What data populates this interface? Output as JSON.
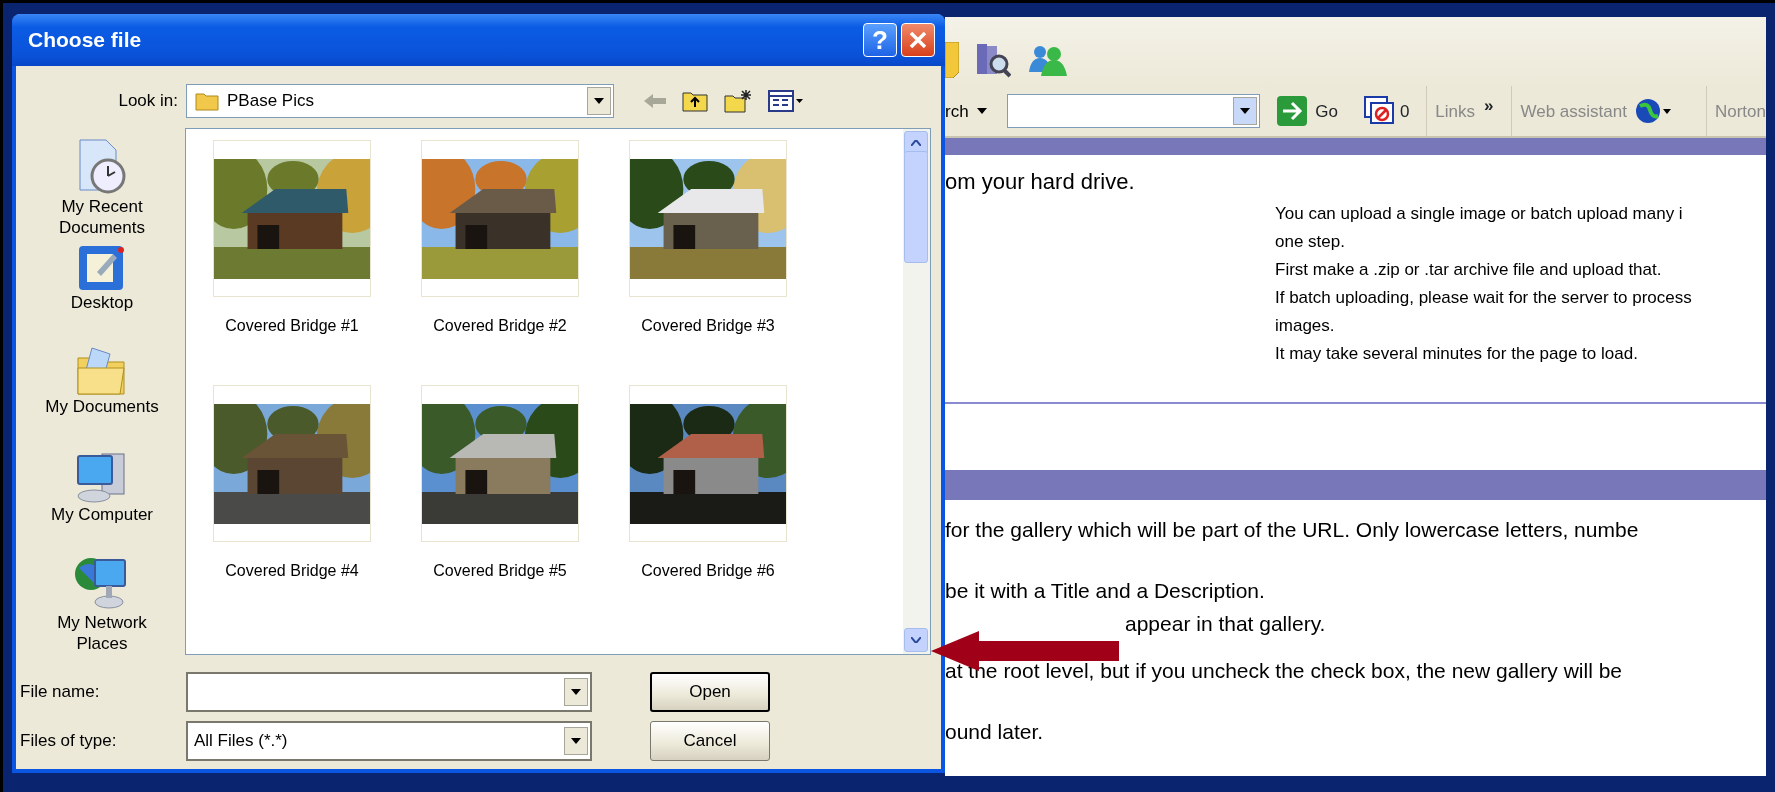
{
  "dialog": {
    "title": "Choose file",
    "help_button": "?",
    "look_in": {
      "label": "Look in:",
      "value": "PBase Pics"
    },
    "places": [
      {
        "label": "My Recent Documents"
      },
      {
        "label": "Desktop"
      },
      {
        "label": "My Documents"
      },
      {
        "label": "My Computer"
      },
      {
        "label": "My Network Places"
      }
    ],
    "files": [
      {
        "name": "Covered Bridge #1",
        "kind": "picture"
      },
      {
        "name": "Covered Bridge #2",
        "kind": "picture"
      },
      {
        "name": "Covered Bridge #3",
        "kind": "picture"
      },
      {
        "name": "Covered Bridge #4",
        "kind": "picture"
      },
      {
        "name": "Covered Bridge #5",
        "kind": "picture"
      },
      {
        "name": "Covered Bridge #6",
        "kind": "picture"
      }
    ],
    "file_name": {
      "label": "File name:"
    },
    "file_type": {
      "label": "Files of type:",
      "value": "All Files (*.*)"
    },
    "buttons": [
      {
        "label": "Open",
        "default": true
      },
      {
        "label": "Cancel",
        "default": false
      }
    ]
  },
  "browser": {
    "search_label": "rch",
    "go_button": "Go",
    "blocked_count": "0",
    "links_label": "Links",
    "links_chevron": "»",
    "web_assistant": "Web assistant",
    "norton": "Norton",
    "intro": "om your hard drive.",
    "notes": [
      "You can upload a single image or batch upload many i",
      "one step.",
      "First make a .zip or .tar archive file and upload that.",
      "If batch uploading, please wait for the server to process",
      "images.",
      "It may take several minutes for the page to load."
    ],
    "paragraphs": [
      {
        "lines": [
          "for the gallery which will be part of the URL. Only lowercase letters, numbe"
        ]
      },
      {
        "lines": [
          "be it with a Title and a Description.",
          "appear in that gallery.",
          "at the root level, but if you uncheck the check box, the new gallery will be"
        ]
      },
      {
        "lines": [
          "ound later."
        ]
      }
    ]
  }
}
